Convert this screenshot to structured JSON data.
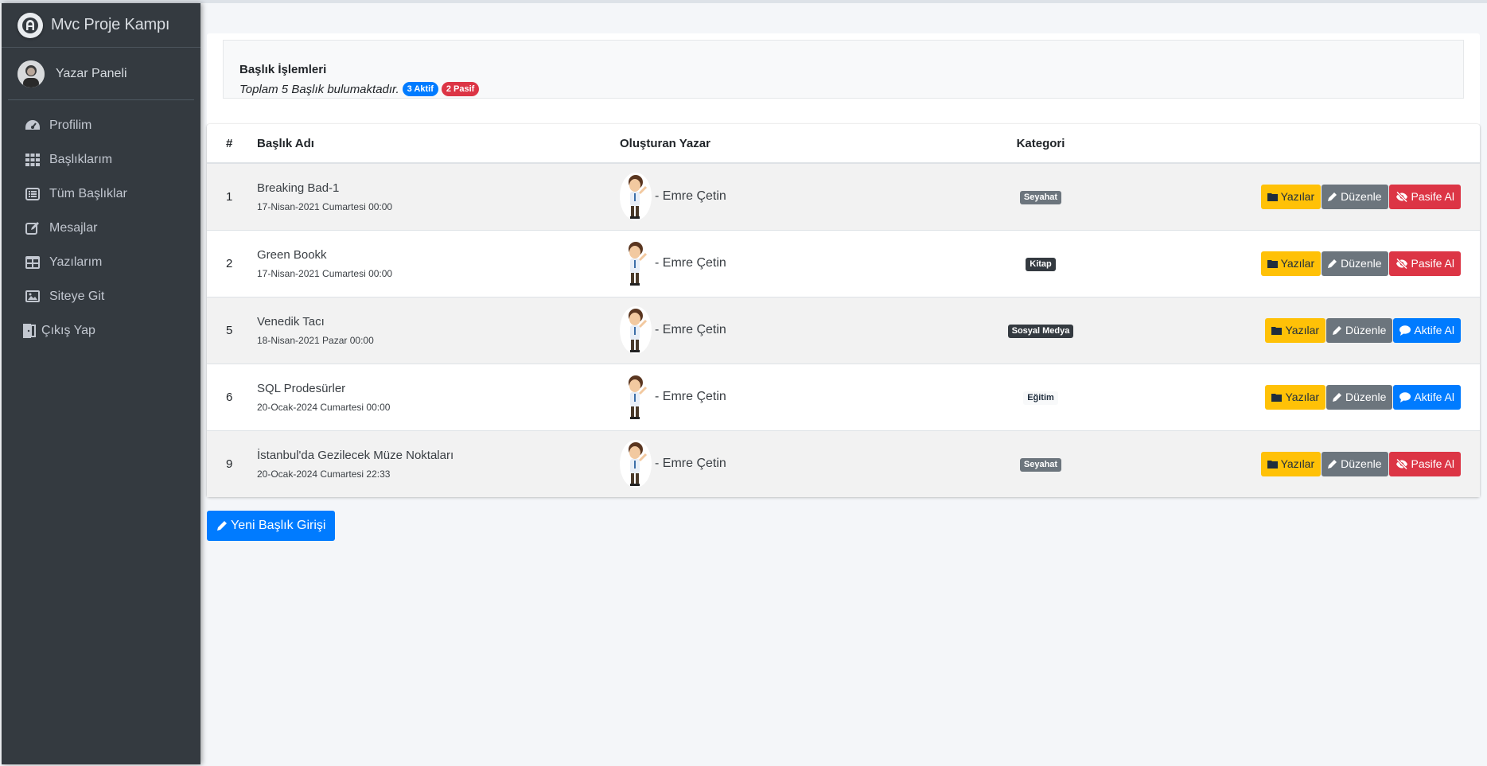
{
  "sidebar": {
    "brand": "Mvc Proje Kampı",
    "user": "Yazar Paneli",
    "items": [
      {
        "label": "Profilim",
        "icon": "dashboard-icon"
      },
      {
        "label": "Başlıklarım",
        "icon": "grid-icon"
      },
      {
        "label": "Tüm Başlıklar",
        "icon": "list-icon"
      },
      {
        "label": "Mesajlar",
        "icon": "edit-icon"
      },
      {
        "label": "Yazılarım",
        "icon": "table-icon"
      },
      {
        "label": "Siteye Git",
        "icon": "image-icon"
      },
      {
        "label": "Çıkış Yap",
        "icon": "door-icon"
      }
    ]
  },
  "info": {
    "title": "Başlık İşlemleri",
    "summary": "Toplam 5 Başlık bulumaktadır.",
    "active_badge": "3 Aktif",
    "passive_badge": "2 Pasif"
  },
  "table": {
    "headers": [
      "#",
      "Başlık Adı",
      "Oluşturan Yazar",
      "Kategori"
    ],
    "rows": [
      {
        "id": "1",
        "title": "Breaking Bad-1",
        "date": "17-Nisan-2021 Cumartesi 00:00",
        "author": "- Emre Çetin",
        "category": "Seyahat",
        "status_action": "Pasife Al"
      },
      {
        "id": "2",
        "title": "Green Bookk",
        "date": "17-Nisan-2021 Cumartesi 00:00",
        "author": "- Emre Çetin",
        "category": "Kitap",
        "status_action": "Pasife Al"
      },
      {
        "id": "5",
        "title": "Venedik Tacı",
        "date": "18-Nisan-2021 Pazar 00:00",
        "author": "- Emre Çetin",
        "category": "Sosyal Medya",
        "status_action": "Aktife Al"
      },
      {
        "id": "6",
        "title": "SQL Prodesürler",
        "date": "20-Ocak-2024 Cumartesi 00:00",
        "author": "- Emre Çetin",
        "category": "Eğitim",
        "status_action": "Aktife Al"
      },
      {
        "id": "9",
        "title": "İstanbul'da Gezilecek Müze Noktaları",
        "date": "20-Ocak-2024 Cumartesi 22:33",
        "author": "- Emre Çetin",
        "category": "Seyahat",
        "status_action": "Pasife Al"
      }
    ],
    "btn_posts": "Yazılar",
    "btn_edit": "Düzenle"
  },
  "new_button": "Yeni Başlık Girişi",
  "colors": {
    "sidebar": "#343a40",
    "primary": "#007bff",
    "warning": "#ffc107",
    "secondary": "#6c757d",
    "danger": "#dc3545"
  }
}
